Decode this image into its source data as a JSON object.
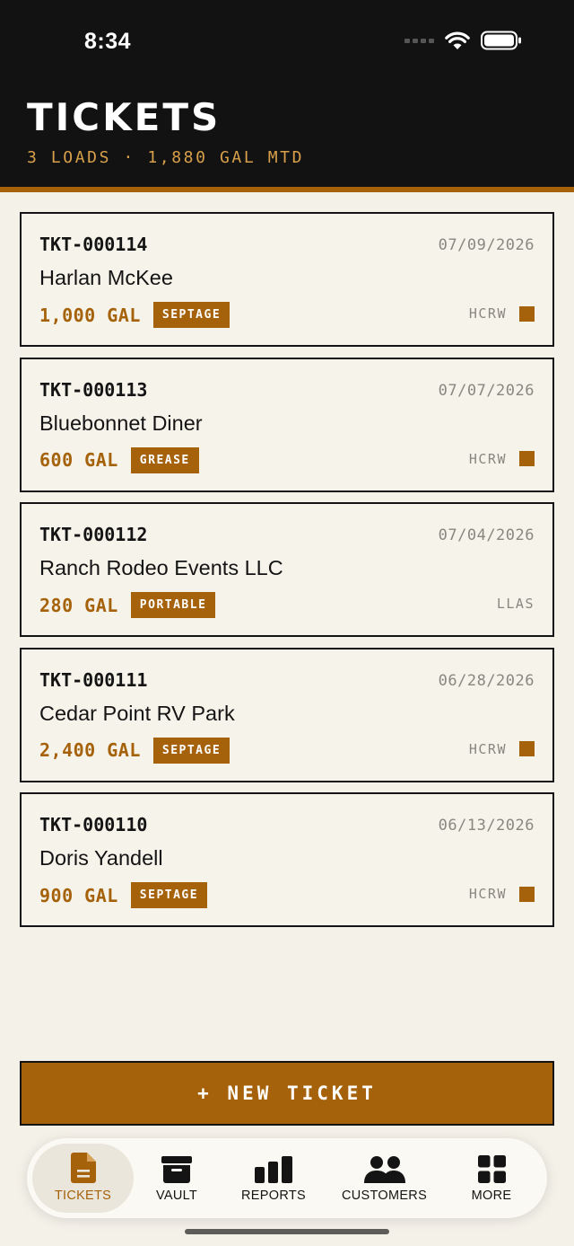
{
  "status_bar": {
    "time": "8:34"
  },
  "header": {
    "title": "TICKETS",
    "subtitle": "3 LOADS · 1,880 GAL MTD"
  },
  "tickets": [
    {
      "id": "TKT-000114",
      "date": "07/09/2026",
      "customer": "Harlan McKee",
      "gallons": "1,000 GAL",
      "type": "SEPTAGE",
      "code": "HCRW",
      "flagged": true
    },
    {
      "id": "TKT-000113",
      "date": "07/07/2026",
      "customer": "Bluebonnet Diner",
      "gallons": "600 GAL",
      "type": "GREASE",
      "code": "HCRW",
      "flagged": true
    },
    {
      "id": "TKT-000112",
      "date": "07/04/2026",
      "customer": "Ranch Rodeo Events LLC",
      "gallons": "280 GAL",
      "type": "PORTABLE",
      "code": "LLAS",
      "flagged": false
    },
    {
      "id": "TKT-000111",
      "date": "06/28/2026",
      "customer": "Cedar Point RV Park",
      "gallons": "2,400 GAL",
      "type": "SEPTAGE",
      "code": "HCRW",
      "flagged": true
    },
    {
      "id": "TKT-000110",
      "date": "06/13/2026",
      "customer": "Doris Yandell",
      "gallons": "900 GAL",
      "type": "SEPTAGE",
      "code": "HCRW",
      "flagged": true
    }
  ],
  "new_ticket_label": "+ NEW TICKET",
  "tabs": [
    {
      "label": "TICKETS",
      "icon": "document-icon",
      "active": true
    },
    {
      "label": "VAULT",
      "icon": "archive-box-icon",
      "active": false
    },
    {
      "label": "REPORTS",
      "icon": "bar-chart-icon",
      "active": false
    },
    {
      "label": "CUSTOMERS",
      "icon": "users-icon",
      "active": false
    },
    {
      "label": "MORE",
      "icon": "grid-icon",
      "active": false
    }
  ],
  "colors": {
    "accent": "#a5620a",
    "header_bg": "#121212",
    "page_bg": "#f4f1e9",
    "subtitle": "#d8a04a"
  }
}
